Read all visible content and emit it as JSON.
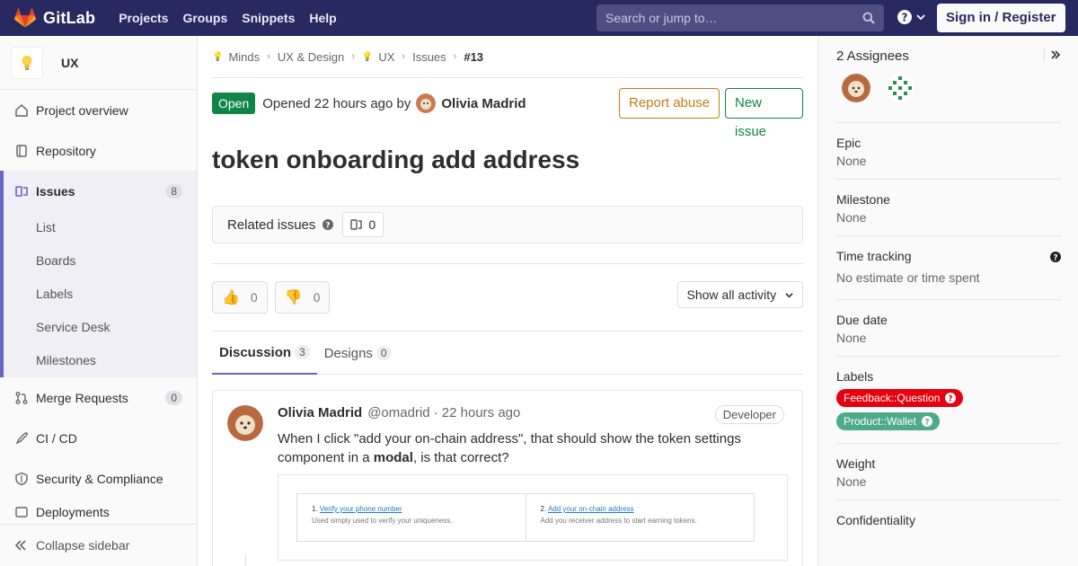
{
  "topnav": {
    "brand": "GitLab",
    "links": [
      "Projects",
      "Groups",
      "Snippets",
      "Help"
    ],
    "search_placeholder": "Search or jump to…",
    "signin": "Sign in / Register"
  },
  "sidebar": {
    "project_name": "UX",
    "items": [
      {
        "label": "Project overview"
      },
      {
        "label": "Repository"
      },
      {
        "label": "Issues",
        "count": "8"
      },
      {
        "label": "Merge Requests",
        "count": "0"
      },
      {
        "label": "CI / CD"
      },
      {
        "label": "Security & Compliance"
      },
      {
        "label": "Deployments"
      }
    ],
    "issues_sub": [
      "List",
      "Boards",
      "Labels",
      "Service Desk",
      "Milestones"
    ],
    "collapse": "Collapse sidebar"
  },
  "breadcrumb": [
    "Minds",
    "UX & Design",
    "UX",
    "Issues",
    "#13"
  ],
  "issue": {
    "status": "Open",
    "opened": "Opened 22 hours ago by",
    "author": "Olivia Madrid",
    "report_abuse": "Report abuse",
    "new_issue": "New issue",
    "title": "token onboarding add address",
    "related_label": "Related issues",
    "related_count": "0",
    "thumbs_up": "0",
    "thumbs_down": "0",
    "activity_filter": "Show all activity"
  },
  "tabs": [
    {
      "label": "Discussion",
      "count": "3"
    },
    {
      "label": "Designs",
      "count": "0"
    }
  ],
  "note": {
    "author": "Olivia Madrid",
    "handle": "@omadrid",
    "time": "· 22 hours ago",
    "role": "Developer",
    "body_pre": "When I click \"add your on-chain address\", that should show the token settings component in a ",
    "body_bold": "modal",
    "body_post": ", is that correct?",
    "image": {
      "step1_num": "1.",
      "step1_link": "Verify your phone number",
      "step1_desc": "Used simply used to verify your uniqueness.",
      "step2_num": "2.",
      "step2_link": "Add your on-chain address",
      "step2_desc": "Add you receiver address to start earning tokens."
    }
  },
  "right_sidebar": {
    "assignees": "2 Assignees",
    "epic": {
      "title": "Epic",
      "value": "None"
    },
    "milestone": {
      "title": "Milestone",
      "value": "None"
    },
    "time_tracking": {
      "title": "Time tracking",
      "value": "No estimate or time spent"
    },
    "due_date": {
      "title": "Due date",
      "value": "None"
    },
    "labels": {
      "title": "Labels",
      "items": [
        {
          "text": "Feedback::Question",
          "color": "#e6000f"
        },
        {
          "text": "Product::Wallet",
          "color": "#4eaa8a"
        }
      ]
    },
    "weight": {
      "title": "Weight",
      "value": "None"
    },
    "confidentiality": {
      "title": "Confidentiality"
    }
  },
  "colors": {
    "nav_bg": "#292961",
    "open_green": "#108548",
    "report_orange": "#c17d10",
    "accent": "#6666c4"
  }
}
